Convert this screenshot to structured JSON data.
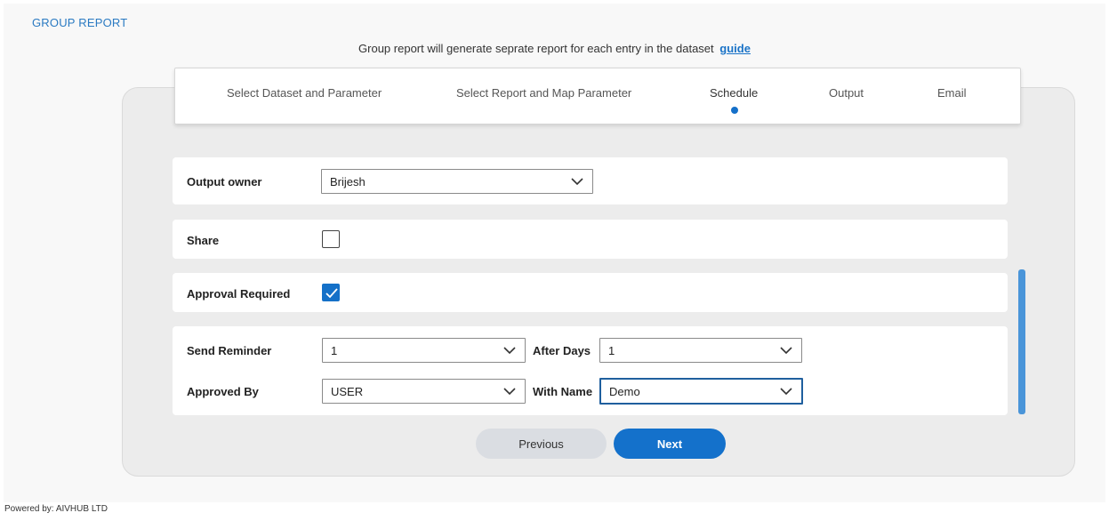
{
  "header": {
    "title": "GROUP REPORT",
    "subtitle": "Group report will generate seprate report for each entry in the dataset",
    "guide_link": "guide"
  },
  "stepper": {
    "steps": [
      {
        "label": "Select Dataset and Parameter",
        "active": false
      },
      {
        "label": "Select Report and Map Parameter",
        "active": false
      },
      {
        "label": "Schedule",
        "active": true
      },
      {
        "label": "Output",
        "active": false
      },
      {
        "label": "Email",
        "active": false
      }
    ]
  },
  "form": {
    "output_owner": {
      "label": "Output owner",
      "value": "Brijesh"
    },
    "share": {
      "label": "Share",
      "checked": false
    },
    "approval_required": {
      "label": "Approval Required",
      "checked": true
    },
    "send_reminder": {
      "label": "Send Reminder",
      "value": "1"
    },
    "after_days": {
      "label": "After Days",
      "value": "1"
    },
    "approved_by": {
      "label": "Approved By",
      "value": "USER"
    },
    "with_name": {
      "label": "With Name",
      "value": "Demo"
    }
  },
  "actions": {
    "previous_label": "Previous",
    "next_label": "Next"
  },
  "footer": {
    "powered_by": "Powered by: AIVHUB LTD"
  },
  "colors": {
    "accent": "#1471cb",
    "title": "#2a7ac2",
    "scrollbar": "#4a95d9"
  }
}
